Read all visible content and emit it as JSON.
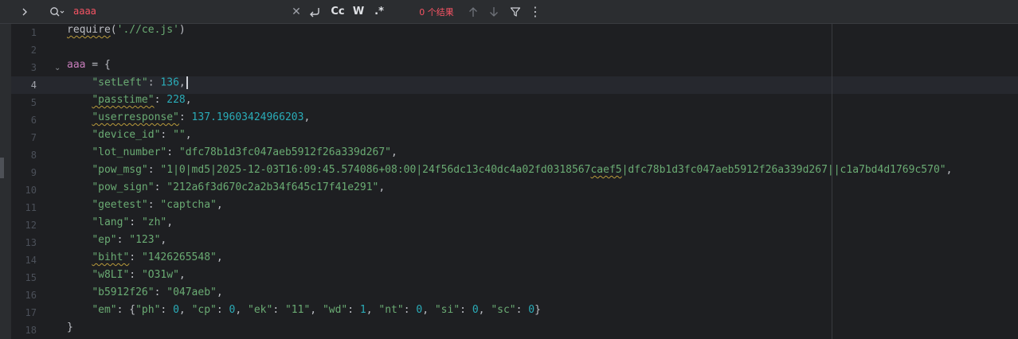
{
  "find_bar": {
    "query": "aaaa",
    "result_count": "0 个结果",
    "icons": {
      "expand": "chevron-right-icon",
      "search": "search-history-icon",
      "clear": "close-icon",
      "newline": "newline-icon",
      "prev": "arrow-up-icon",
      "next": "arrow-down-icon",
      "filter": "filter-icon",
      "more": "more-vertical-icon"
    },
    "toggles": {
      "match_case": "Cc",
      "words": "W",
      "regex": ".*"
    }
  },
  "editor": {
    "current_line": 4,
    "line_numbers": [
      "1",
      "2",
      "3",
      "4",
      "5",
      "6",
      "7",
      "8",
      "9",
      "10",
      "11",
      "12",
      "13",
      "14",
      "15",
      "16",
      "17",
      "18"
    ],
    "line1": {
      "fn": "require",
      "arg": "'.//ce.js'"
    },
    "line3": {
      "var": "aaa",
      "op": " = {"
    },
    "entries": [
      {
        "key": "\"setLeft\"",
        "val": "136"
      },
      {
        "key": "\"passtime\"",
        "val": "228"
      },
      {
        "key": "\"userresponse\"",
        "val": "137.19603424966203"
      },
      {
        "key": "\"device_id\"",
        "val": "\"\""
      },
      {
        "key": "\"lot_number\"",
        "val": "\"dfc78b1d3fc047aeb5912f26a339d267\""
      },
      {
        "key": "\"pow_msg\"",
        "val": "\"1|0|md5|2025-12-03T16:09:45.574086+08:00|24f56dc13c40dc4a02fd0318567caef5|dfc78b1d3fc047aeb5912f26a339d267||c1a7bd4d1769c570\""
      },
      {
        "key": "\"pow_sign\"",
        "val": "\"212a6f3d670c2a2b34f645c17f41e291\""
      },
      {
        "key": "\"geetest\"",
        "val": "\"captcha\""
      },
      {
        "key": "\"lang\"",
        "val": "\"zh\""
      },
      {
        "key": "\"ep\"",
        "val": "\"123\""
      },
      {
        "key": "\"biht\"",
        "val": "\"1426265548\""
      },
      {
        "key": "\"w8LI\"",
        "val": "\"O31w\""
      },
      {
        "key": "\"b5912f26\"",
        "val": "\"047aeb\""
      }
    ],
    "em": {
      "key": "\"em\"",
      "pairs": [
        {
          "k": "\"ph\"",
          "v": "0"
        },
        {
          "k": "\"cp\"",
          "v": "0"
        },
        {
          "k": "\"ek\"",
          "v": "\"11\""
        },
        {
          "k": "\"wd\"",
          "v": "1"
        },
        {
          "k": "\"nt\"",
          "v": "0"
        },
        {
          "k": "\"si\"",
          "v": "0"
        },
        {
          "k": "\"sc\"",
          "v": "0"
        }
      ]
    },
    "closing": "}"
  }
}
